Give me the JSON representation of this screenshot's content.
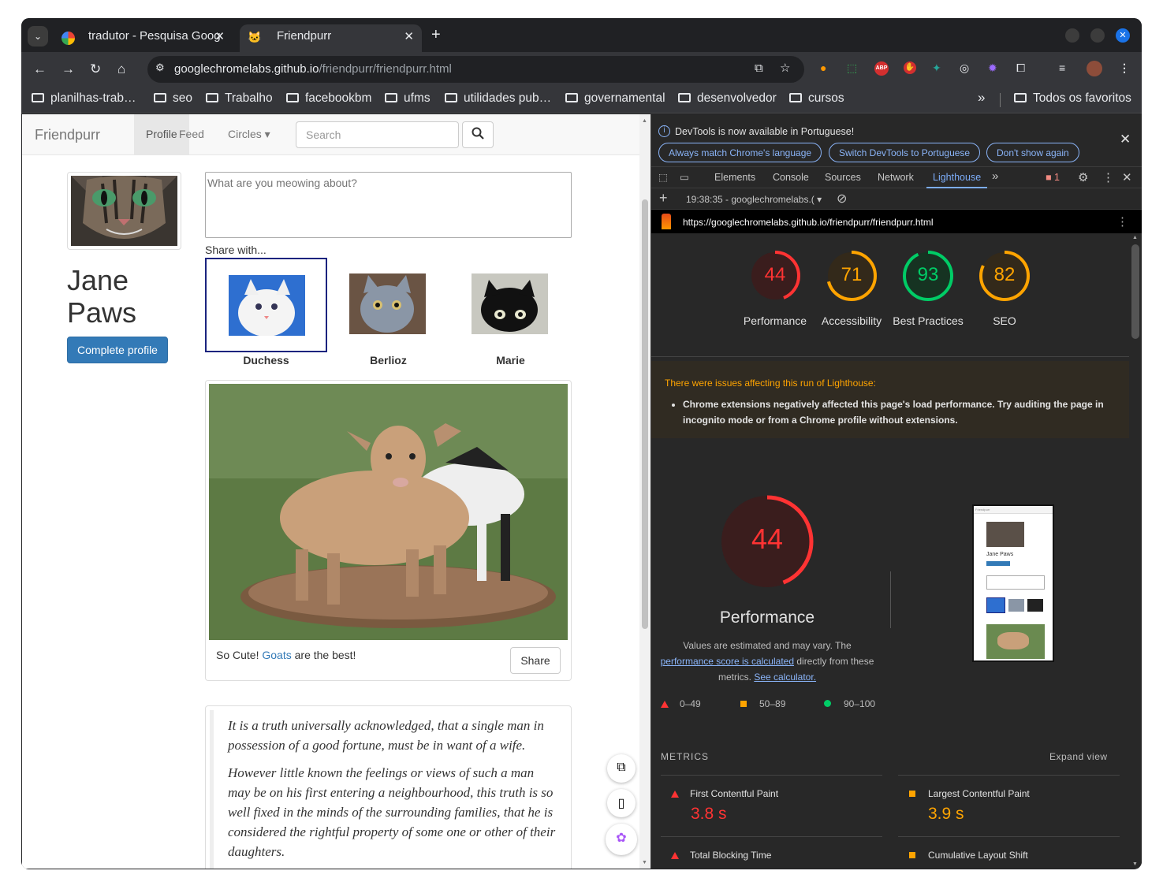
{
  "browser": {
    "tabs": [
      {
        "title": "tradutor - Pesquisa Goog"
      },
      {
        "title": "Friendpurr"
      }
    ],
    "url_host": "googlechromelabs.github.io",
    "url_path": "/friendpurr/friendpurr.html",
    "bookmarks": [
      "planilhas-trab…",
      "seo",
      "Trabalho",
      "facebookbm",
      "ufms",
      "utilidades pub…",
      "governamental",
      "desenvolvedor",
      "cursos"
    ],
    "all_bookmarks": "Todos os favoritos",
    "more_bookmarks": "»"
  },
  "site": {
    "brand": "Friendpurr",
    "nav": [
      "Profile",
      "Feed",
      "Circles ▾"
    ],
    "search_placeholder": "Search",
    "profile_first": "Jane",
    "profile_last": "Paws",
    "complete_button": "Complete profile",
    "meow_placeholder": "What are you meowing about?",
    "share_with": "Share with...",
    "cats": [
      "Duchess",
      "Berlioz",
      "Marie"
    ],
    "post_caption_before": "So Cute! ",
    "post_caption_link": "Goats",
    "post_caption_after": " are the best!",
    "share_button": "Share",
    "quote_p1": "It is a truth universally acknowledged, that a single man in possession of a good fortune, must be in want of a wife.",
    "quote_p2": "However little known the feelings or views of such a man may be on his first entering a neighbourhood, this truth is so well fixed in the minds of the surrounding families, that he is considered the rightful property of some one or other of their daughters."
  },
  "devtools": {
    "info_text": "DevTools is now available in Portuguese!",
    "info_buttons": [
      "Always match Chrome's language",
      "Switch DevTools to Portuguese",
      "Don't show again"
    ],
    "tabs": [
      "Elements",
      "Console",
      "Sources",
      "Network",
      "Lighthouse"
    ],
    "active_tab": "Lighthouse",
    "error_count": "1",
    "report_selector": "19:38:35 - googlechromelabs.(",
    "report_url": "https://googlechromelabs.github.io/friendpurr/friendpurr.html",
    "scores": [
      {
        "label": "Performance",
        "value": 44,
        "color": "#ff3333"
      },
      {
        "label": "Accessibility",
        "value": 71,
        "color": "#ffa400"
      },
      {
        "label": "Best Practices",
        "value": 93,
        "color": "#00cc66"
      },
      {
        "label": "SEO",
        "value": 82,
        "color": "#ffa400"
      }
    ],
    "warning_title": "There were issues affecting this run of Lighthouse:",
    "warning_item": "Chrome extensions negatively affected this page's load performance. Try auditing the page in incognito mode or from a Chrome profile without extensions.",
    "perf_title": "Performance",
    "perf_desc_1": "Values are estimated and may vary. The ",
    "perf_link_1": "performance score is calculated",
    "perf_desc_2": " directly from these metrics. ",
    "perf_link_2": "See calculator.",
    "legend": [
      "0–49",
      "50–89",
      "90–100"
    ],
    "metrics_title": "METRICS",
    "expand_view": "Expand view",
    "metrics": [
      {
        "name": "First Contentful Paint",
        "value": "3.8 s",
        "status": "fail"
      },
      {
        "name": "Largest Contentful Paint",
        "value": "3.9 s",
        "status": "average"
      },
      {
        "name": "Total Blocking Time",
        "value": "",
        "status": "fail"
      },
      {
        "name": "Cumulative Layout Shift",
        "value": "",
        "status": "average"
      }
    ],
    "thumb_name": "Jane Paws"
  }
}
